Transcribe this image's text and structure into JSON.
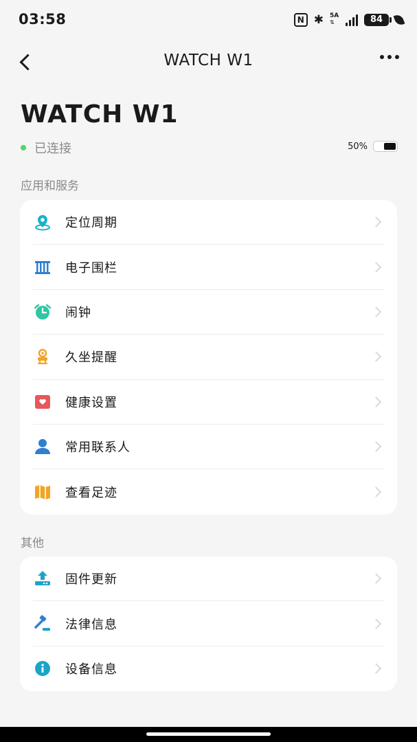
{
  "status_bar": {
    "time": "03:58",
    "nfc_label": "N",
    "bluetooth": "✱",
    "network_type": "5A",
    "network_arrows": "⇅",
    "battery": "84",
    "icons": [
      "nfc-icon",
      "bluetooth-icon",
      "signal-icon",
      "battery-icon",
      "leaf-icon"
    ]
  },
  "nav": {
    "title": "WATCH W1",
    "back_icon": "back-arrow-icon",
    "more_icon": "more-dots-icon"
  },
  "device": {
    "name": "WATCH W1",
    "status": "已连接",
    "status_color": "#4cd964",
    "battery_text": "50%",
    "battery_level": 0.5
  },
  "sections": {
    "apps_label": "应用和服务",
    "other_label": "其他"
  },
  "apps": [
    {
      "label": "定位周期",
      "icon": "location-pin-icon",
      "color": "#1ab2c8"
    },
    {
      "label": "电子围栏",
      "icon": "fence-icon",
      "color": "#2f7fd1"
    },
    {
      "label": "闹钟",
      "icon": "alarm-clock-icon",
      "color": "#2fc7a6"
    },
    {
      "label": "久坐提醒",
      "icon": "sedentary-icon",
      "color": "#f2a424"
    },
    {
      "label": "健康设置",
      "icon": "heart-icon",
      "color": "#e8575a"
    },
    {
      "label": "常用联系人",
      "icon": "contact-icon",
      "color": "#2f7fd1"
    },
    {
      "label": "查看足迹",
      "icon": "map-icon",
      "color": "#f2a424"
    }
  ],
  "others": [
    {
      "label": "固件更新",
      "icon": "firmware-upload-icon",
      "color": "#1aa5c8"
    },
    {
      "label": "法律信息",
      "icon": "gavel-icon",
      "color": "#2f7fd1"
    },
    {
      "label": "设备信息",
      "icon": "info-icon",
      "color": "#1aa5c8"
    }
  ]
}
